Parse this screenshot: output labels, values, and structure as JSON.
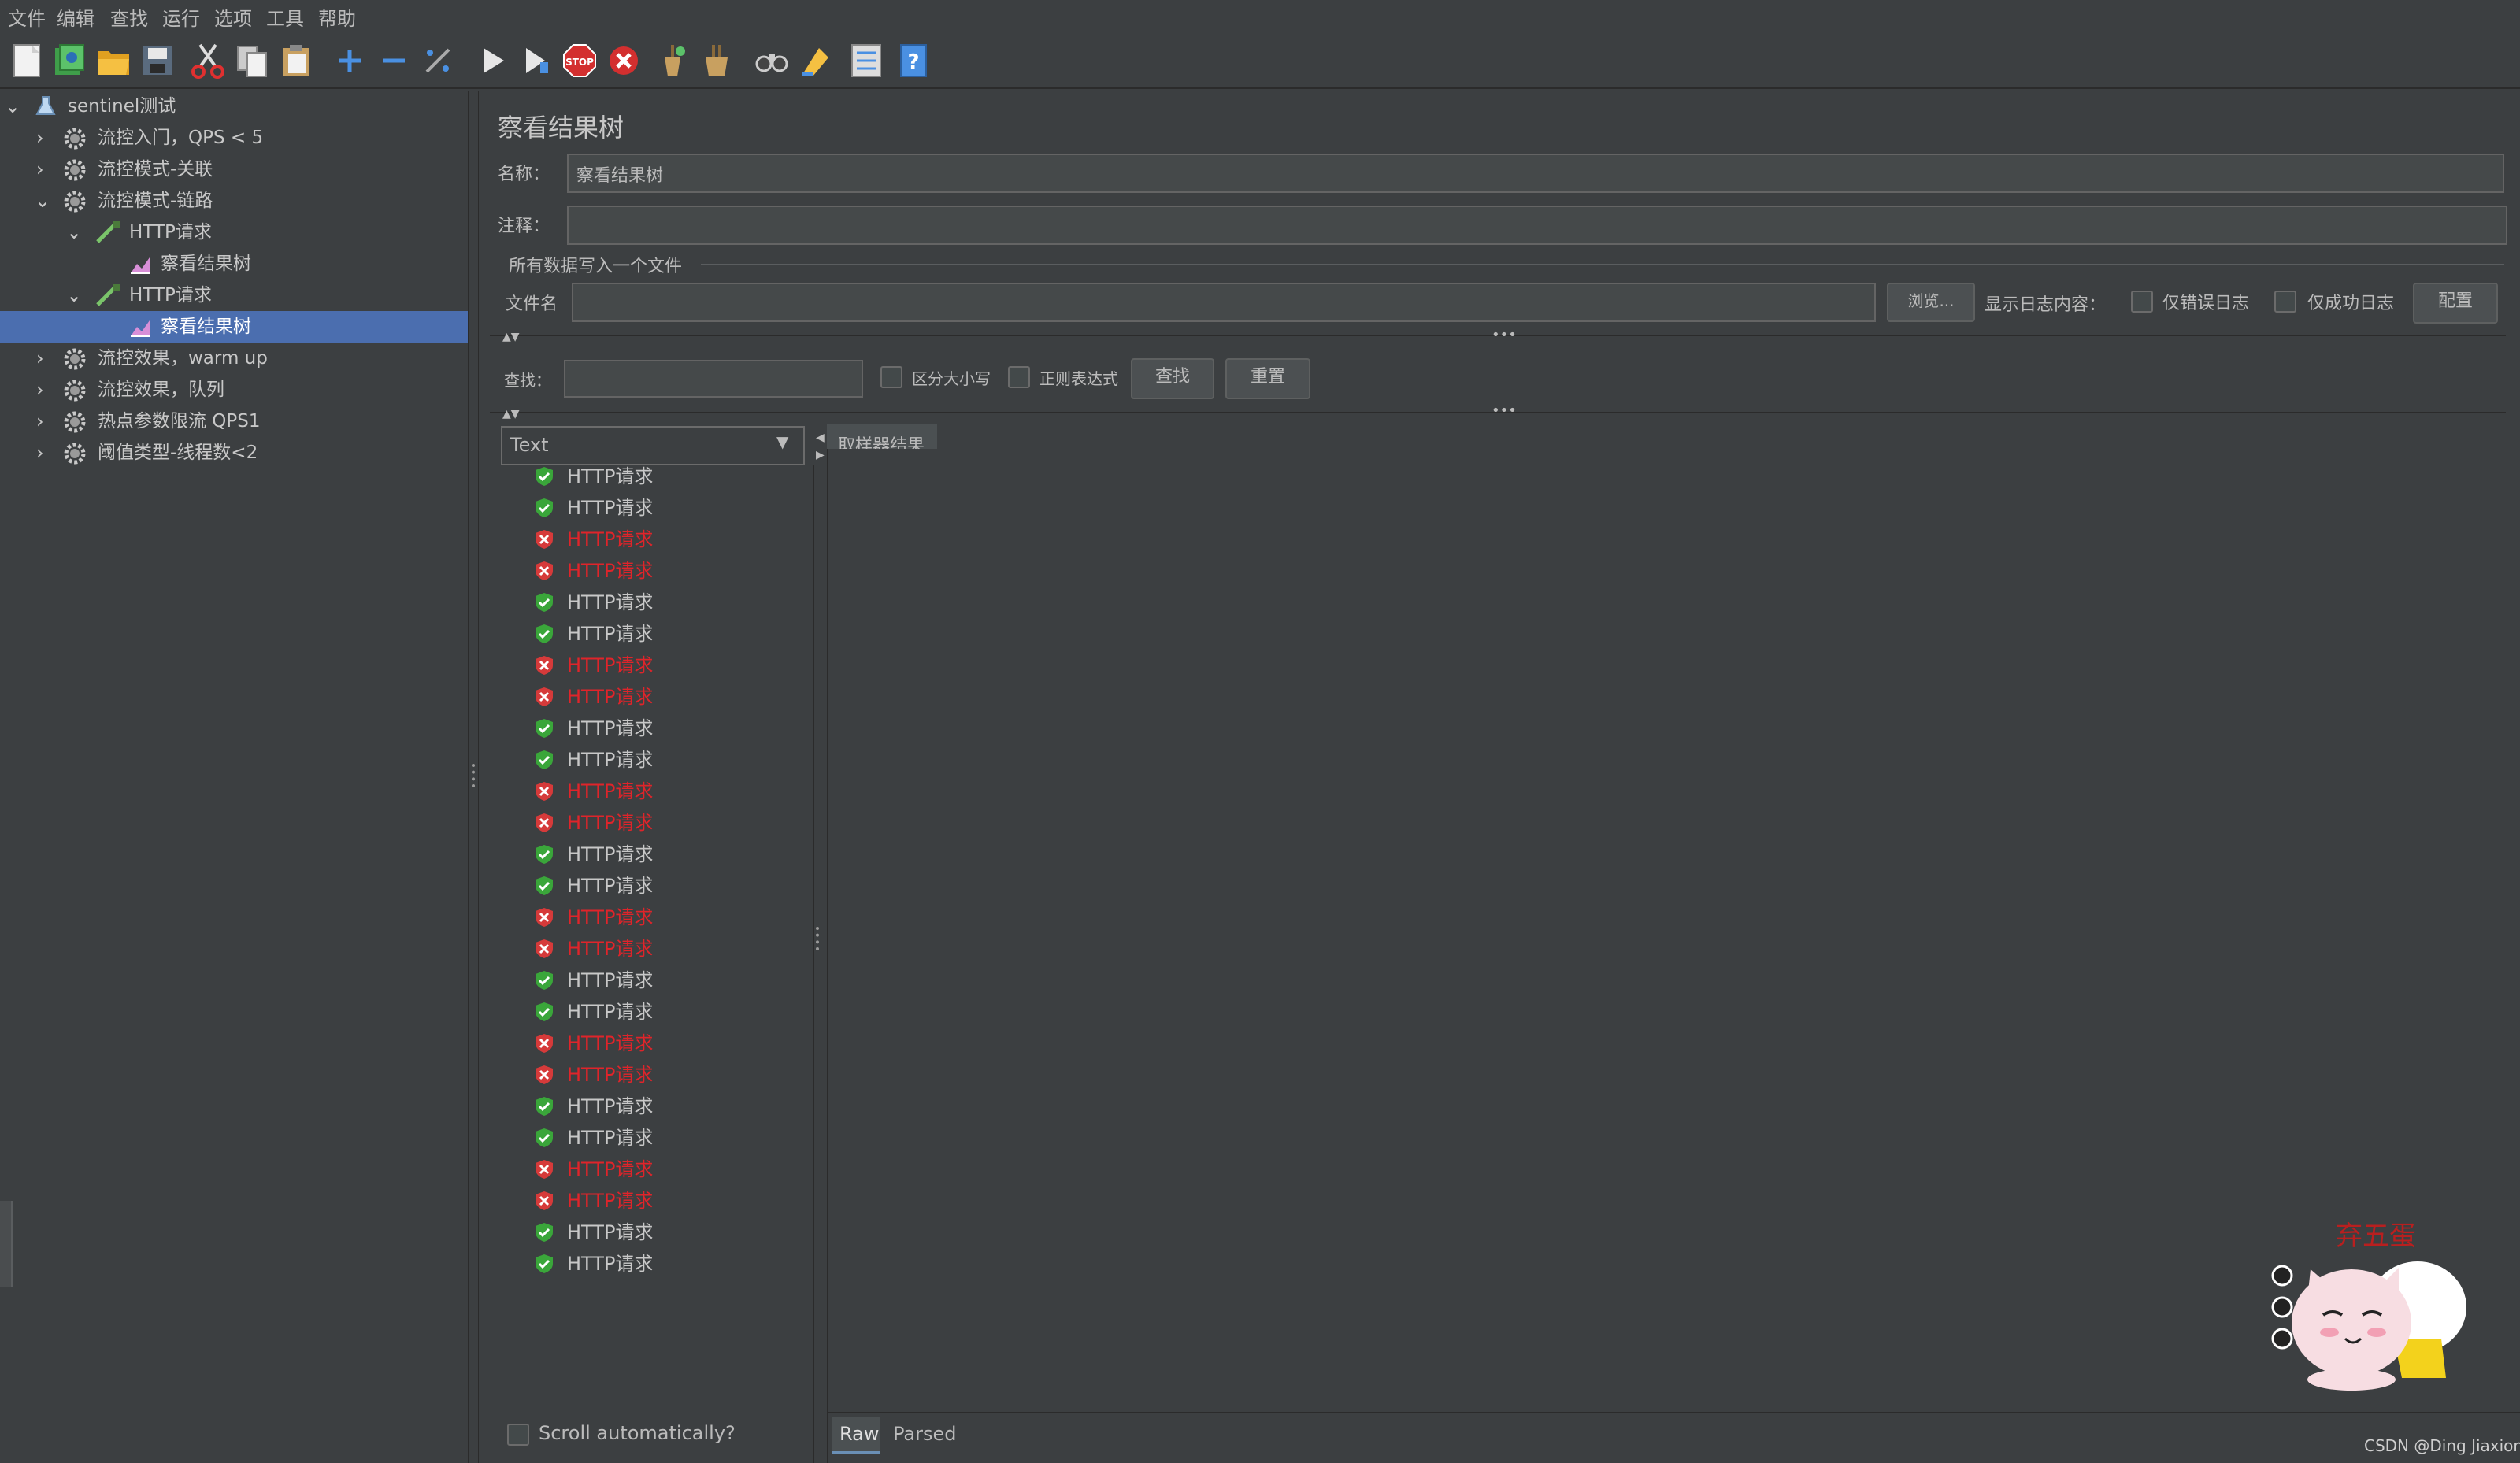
{
  "menu": [
    "文件",
    "编辑",
    "查找",
    "运行",
    "选项",
    "工具",
    "帮助"
  ],
  "toolbar_icons": [
    "new-icon",
    "templates-icon",
    "open-icon",
    "save-icon",
    "cut-icon",
    "copy-icon",
    "paste-icon",
    "expand-icon",
    "collapse-icon",
    "toggle-icon",
    "start-icon",
    "start-no-pause-icon",
    "stop-icon",
    "shutdown-icon",
    "clear-icon",
    "clear-all-icon",
    "search-icon",
    "reset-search-icon",
    "function-helper-icon",
    "help-icon"
  ],
  "tree": {
    "root": "sentinel测试",
    "items": [
      {
        "label": "流控入门，QPS < 5"
      },
      {
        "label": "流控模式-关联"
      },
      {
        "label": "流控模式-链路"
      },
      {
        "label": "HTTP请求"
      },
      {
        "label": "察看结果树"
      },
      {
        "label": "HTTP请求"
      },
      {
        "label": "察看结果树"
      },
      {
        "label": "流控效果，warm up"
      },
      {
        "label": "流控效果，队列"
      },
      {
        "label": "热点参数限流 QPS1"
      },
      {
        "label": "阈值类型-线程数<2"
      }
    ]
  },
  "panel": {
    "title": "察看结果树",
    "name_label": "名称：",
    "name_value": "察看结果树",
    "comment_label": "注释：",
    "comment_value": "",
    "file_section": "所有数据写入一个文件",
    "filename_label": "文件名",
    "filename_value": "",
    "browse_button": "浏览...",
    "log_content_label": "显示日志内容：",
    "errors_only_label": "仅错误日志",
    "success_only_label": "仅成功日志",
    "configure_button": "配置",
    "search_label": "查找：",
    "search_value": "",
    "case_sensitive_label": "区分大小写",
    "regex_label": "正则表达式",
    "find_button": "查找",
    "reset_button": "重置",
    "renderer_select": "Text",
    "sampler_result_tab": "取样器结果",
    "scroll_auto_label": "Scroll automatically?",
    "raw_tab": "Raw",
    "parsed_tab": "Parsed"
  },
  "results": [
    {
      "label": "HTTP请求",
      "status": "success"
    },
    {
      "label": "HTTP请求",
      "status": "success"
    },
    {
      "label": "HTTP请求",
      "status": "error"
    },
    {
      "label": "HTTP请求",
      "status": "error"
    },
    {
      "label": "HTTP请求",
      "status": "success"
    },
    {
      "label": "HTTP请求",
      "status": "success"
    },
    {
      "label": "HTTP请求",
      "status": "error"
    },
    {
      "label": "HTTP请求",
      "status": "error"
    },
    {
      "label": "HTTP请求",
      "status": "success"
    },
    {
      "label": "HTTP请求",
      "status": "success"
    },
    {
      "label": "HTTP请求",
      "status": "error"
    },
    {
      "label": "HTTP请求",
      "status": "error"
    },
    {
      "label": "HTTP请求",
      "status": "success"
    },
    {
      "label": "HTTP请求",
      "status": "success"
    },
    {
      "label": "HTTP请求",
      "status": "error"
    },
    {
      "label": "HTTP请求",
      "status": "error"
    },
    {
      "label": "HTTP请求",
      "status": "success"
    },
    {
      "label": "HTTP请求",
      "status": "success"
    },
    {
      "label": "HTTP请求",
      "status": "error"
    },
    {
      "label": "HTTP请求",
      "status": "error"
    },
    {
      "label": "HTTP请求",
      "status": "success"
    },
    {
      "label": "HTTP请求",
      "status": "success"
    },
    {
      "label": "HTTP请求",
      "status": "error"
    },
    {
      "label": "HTTP请求",
      "status": "error"
    },
    {
      "label": "HTTP请求",
      "status": "success"
    },
    {
      "label": "HTTP请求",
      "status": "success"
    }
  ],
  "watermark": "CSDN @Ding Jiaxiong",
  "sticker_text": "弃五蛋",
  "colors": {
    "background": "#3c3f41",
    "selection": "#4b6eaf",
    "error_text": "#e0242a",
    "success_icon": "#3aa63a",
    "error_icon": "#d63a3a"
  }
}
